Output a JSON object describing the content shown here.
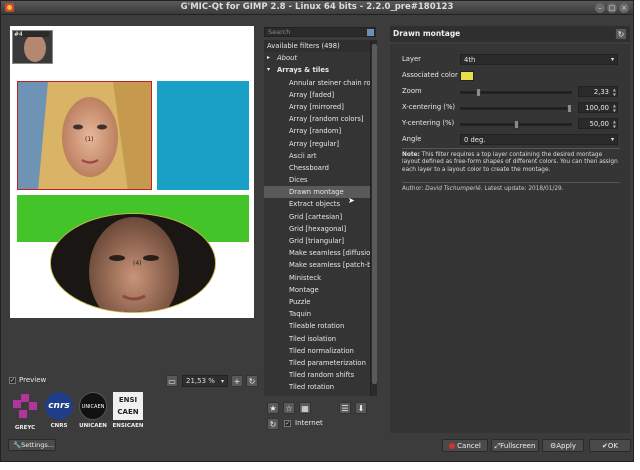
{
  "window": {
    "title": "G'MIC-Qt for GIMP 2.8 - Linux 64 bits - 2.2.0_pre#180123"
  },
  "preview": {
    "thumb_label": "#4",
    "crosshair_1": "(1)",
    "crosshair_2": "(4)",
    "checkbox_label": "Preview",
    "zoom_value": "21,53 %"
  },
  "logos": [
    {
      "name": "GREYC",
      "color": "#b0349b"
    },
    {
      "name": "CNRS",
      "color": "#1f3e87"
    },
    {
      "name": "UNICAEN",
      "color": "#111111"
    },
    {
      "name": "ENSICAEN",
      "color": "#f0f0f0",
      "mark_text": "ENSI CAEN"
    }
  ],
  "settings_label": "Settings...",
  "filters": {
    "search_placeholder": "Search",
    "header": "Available filters (498)",
    "about": "About",
    "category": "Arrays & tiles",
    "items": [
      "Annular steiner chain ro",
      "Array [faded]",
      "Array [mirrored]",
      "Array [random colors]",
      "Array [random]",
      "Array [regular]",
      "Ascii art",
      "Chessboard",
      "Dices",
      "Drawn montage",
      "Extract objects",
      "Grid [cartesian]",
      "Grid [hexagonal]",
      "Grid [triangular]",
      "Make seamless [diffusio",
      "Make seamless [patch-b",
      "Ministeck",
      "Montage",
      "Puzzle",
      "Taquin",
      "Tileable rotation",
      "Tiled isolation",
      "Tiled normalization",
      "Tiled parameterization",
      "Tiled random shifts",
      "Tiled rotation"
    ],
    "selected_index": 9,
    "internet_label": "Internet"
  },
  "params": {
    "title": "Drawn montage",
    "layer_label": "Layer",
    "layer_value": "4th",
    "assoc_color_label": "Associated color",
    "assoc_color": "#e6e04a",
    "zoom_label": "Zoom",
    "zoom_value": "2,33",
    "zoom_fraction": 0.15,
    "xc_label": "X-centering (%)",
    "xc_value": "100,00",
    "xc_fraction": 1.0,
    "yc_label": "Y-centering (%)",
    "yc_value": "50,00",
    "yc_fraction": 0.5,
    "angle_label": "Angle",
    "angle_value": "0 deg.",
    "note_bold": "Note:",
    "note_text": " This filter requires a top layer containing the desired montage layout defined as free-form shapes of different colors. You can then assign each layer to a layout color to create the montage.",
    "author_prefix": "Author: ",
    "author_name": "David Tschumperlé",
    "author_suffix": ". Latest update: 2018/01/29."
  },
  "buttons": {
    "cancel": "Cancel",
    "fullscreen": "Fullscreen",
    "apply": "Apply",
    "ok": "OK"
  }
}
